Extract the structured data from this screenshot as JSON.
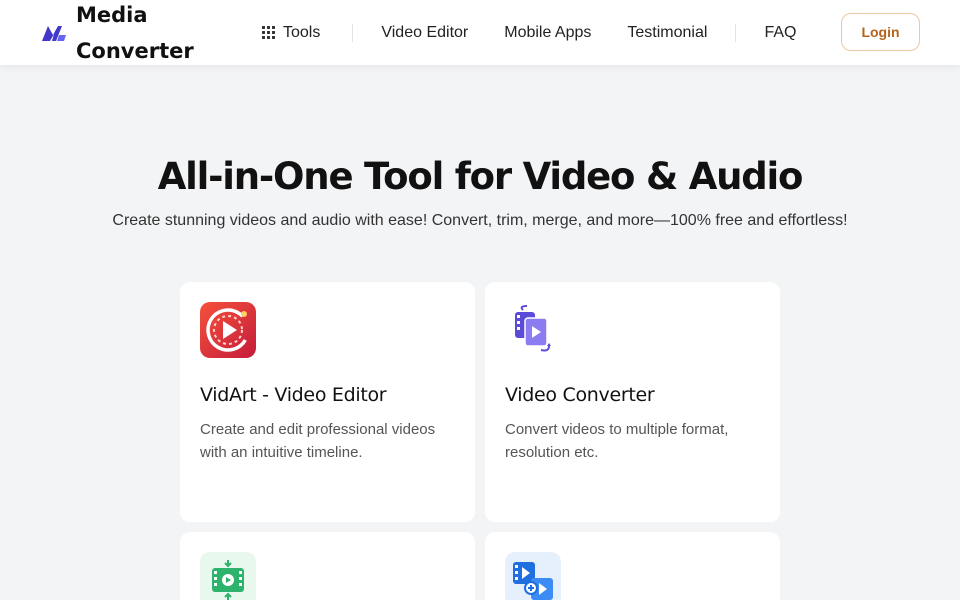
{
  "header": {
    "brand_line1": "Media",
    "brand_line2": "Converter",
    "nav": {
      "tools": "Tools",
      "video_editor": "Video Editor",
      "mobile_apps": "Mobile Apps",
      "testimonial": "Testimonial",
      "faq": "FAQ"
    },
    "login": "Login"
  },
  "hero": {
    "title": "All-in-One Tool for Video & Audio",
    "subtitle": "Create stunning videos and audio with ease! Convert, trim, merge, and more—100% free and effortless!"
  },
  "cards": [
    {
      "title": "VidArt - Video Editor",
      "desc": "Create and edit professional videos with an intuitive timeline.",
      "icon": "vidart-logo-icon"
    },
    {
      "title": "Video Converter",
      "desc": "Convert videos to multiple format, resolution etc.",
      "icon": "video-convert-icon"
    },
    {
      "title": "",
      "desc": "",
      "icon": "video-trim-icon"
    },
    {
      "title": "",
      "desc": "",
      "icon": "video-merge-icon"
    }
  ],
  "colors": {
    "accent": "#b5651d",
    "brand_blue": "#4f46e5",
    "background": "#f3f4f6"
  }
}
